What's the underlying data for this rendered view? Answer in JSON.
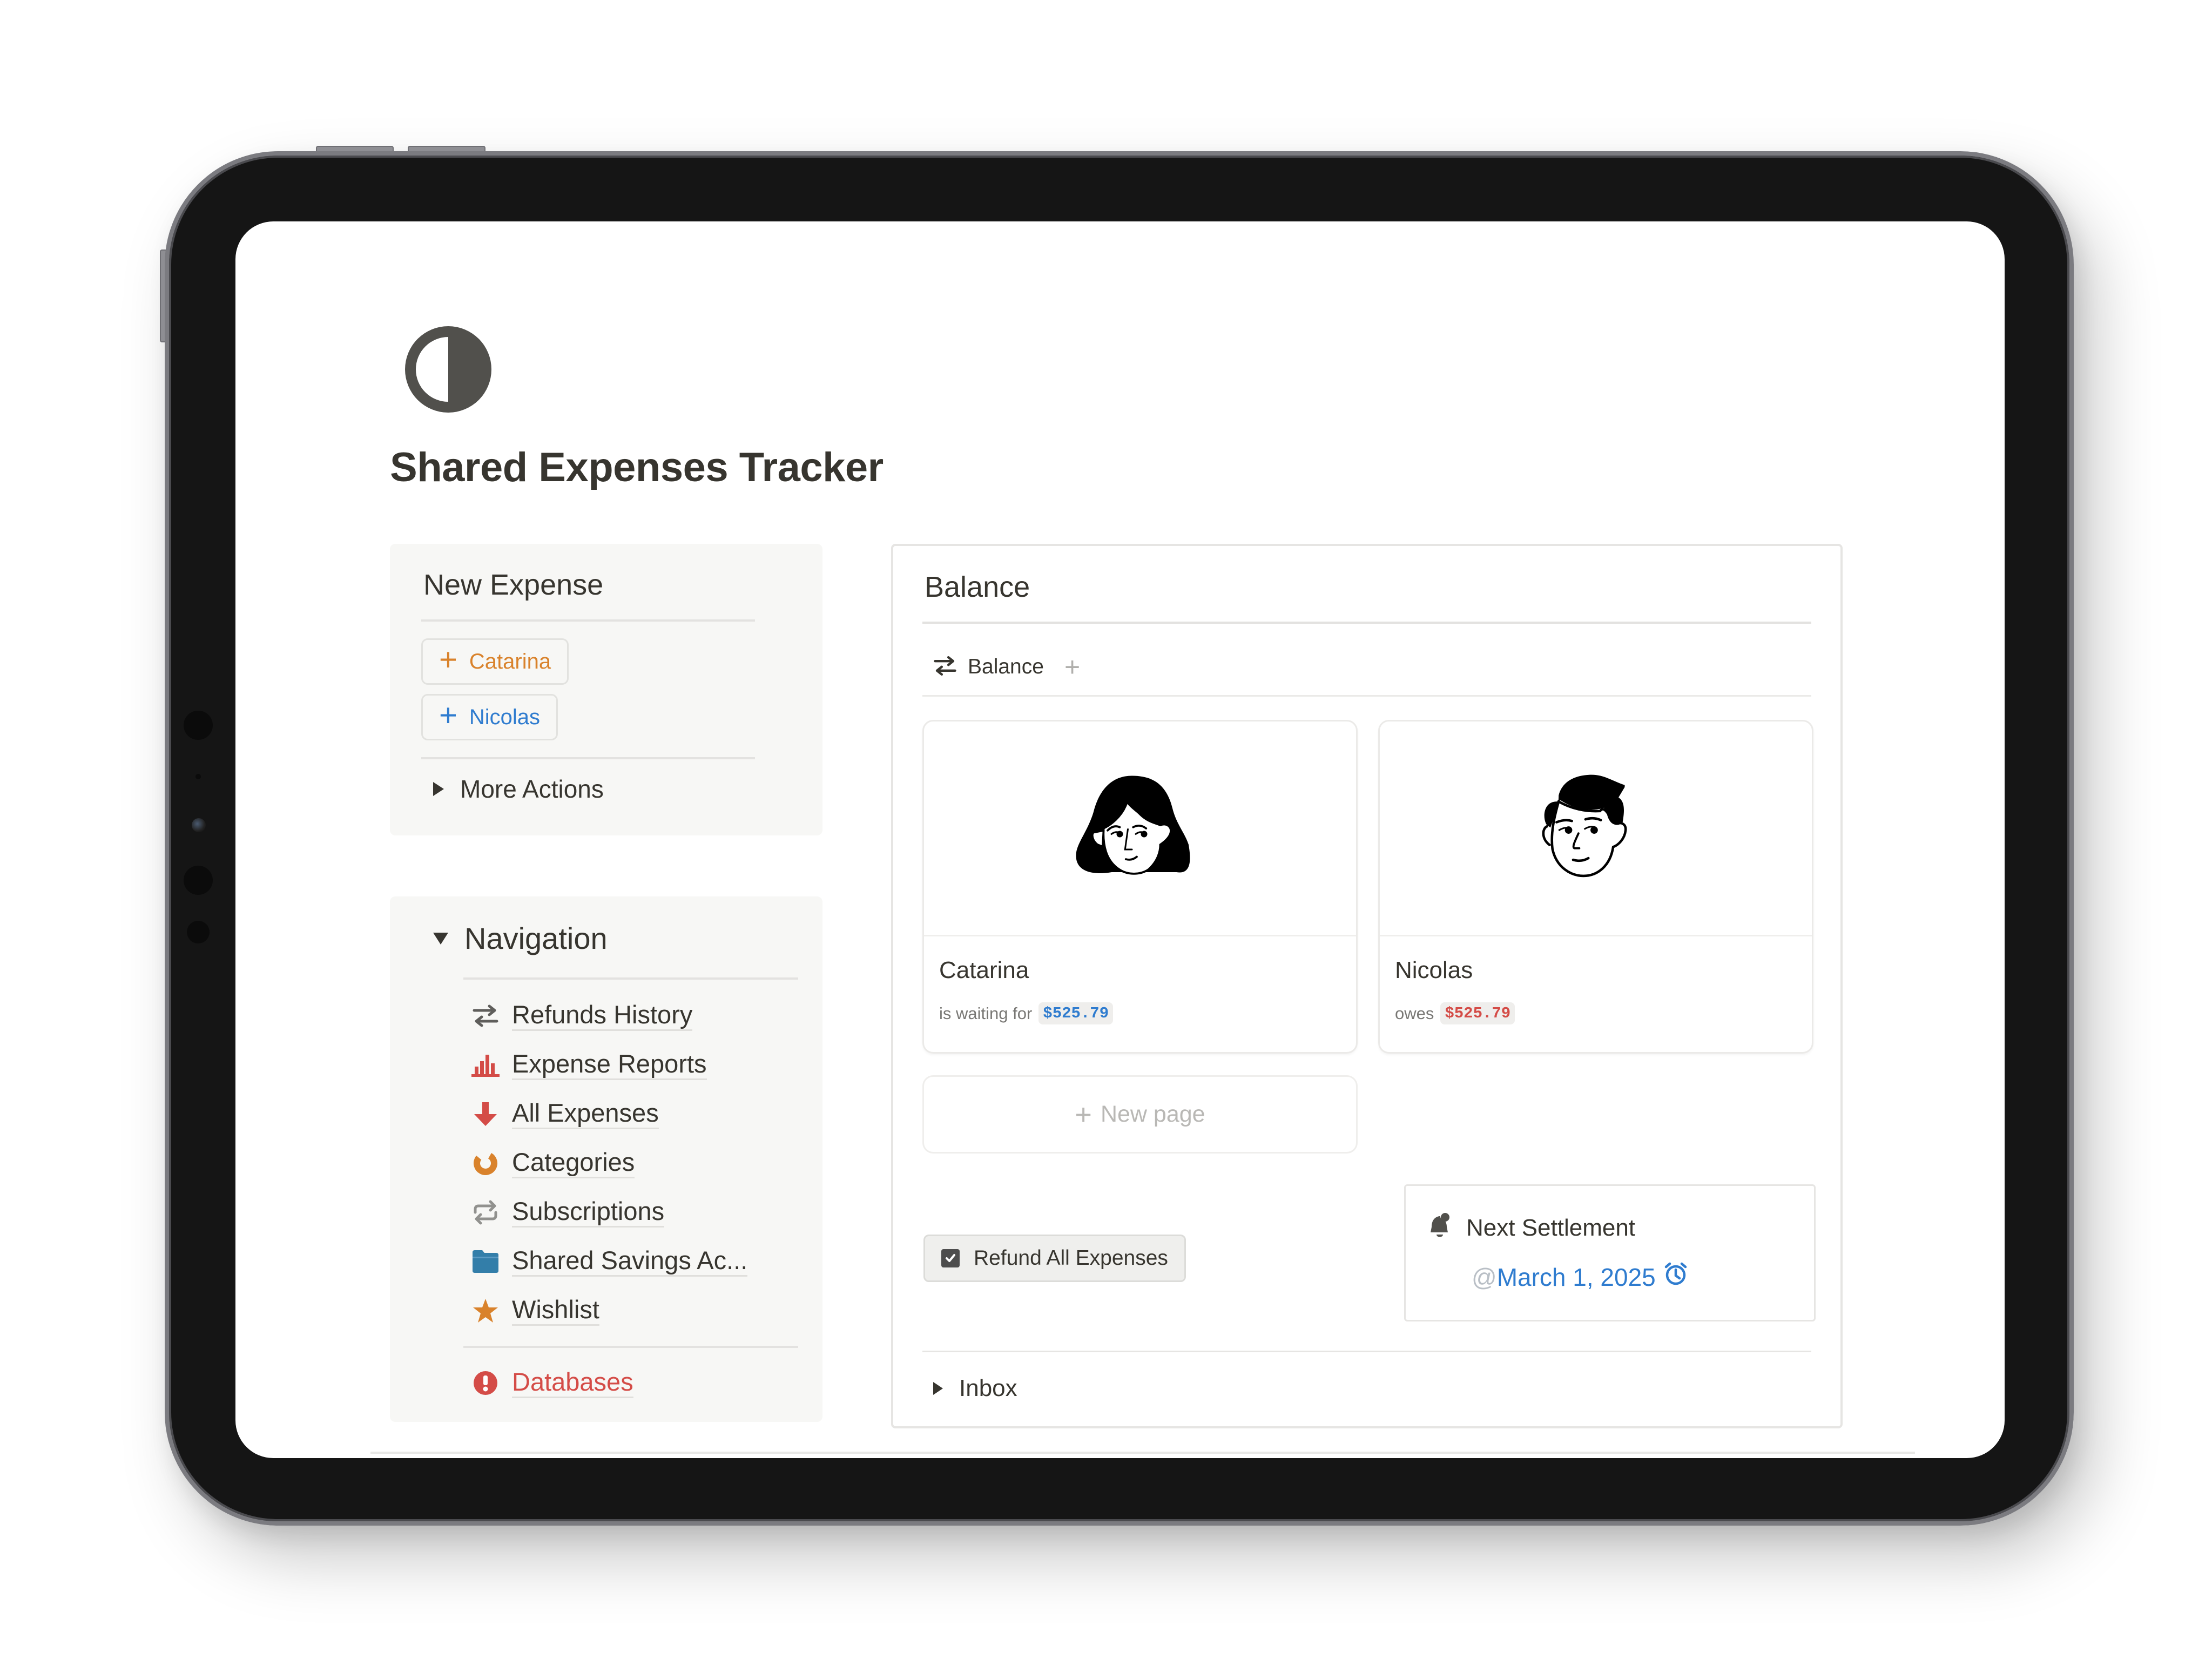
{
  "page": {
    "icon": "half-circle-contrast-icon",
    "title": "Shared Expenses Tracker"
  },
  "new_expense": {
    "heading": "New Expense",
    "buttons": [
      {
        "label": "Catarina",
        "icon": "plus-icon",
        "color": "#d9822b"
      },
      {
        "label": "Nicolas",
        "icon": "plus-icon",
        "color": "#2f7ccf"
      }
    ],
    "more_actions_label": "More Actions"
  },
  "navigation": {
    "heading": "Navigation",
    "items": [
      {
        "label": "Refunds History",
        "icon": "arrows-exchange-icon",
        "color": "#5f5e5b"
      },
      {
        "label": "Expense Reports",
        "icon": "bar-chart-icon",
        "color": "#d44c47"
      },
      {
        "label": "All Expenses",
        "icon": "arrow-down-icon",
        "color": "#d44c47"
      },
      {
        "label": "Categories",
        "icon": "pie-chart-icon",
        "color": "#d9822b"
      },
      {
        "label": "Subscriptions",
        "icon": "repeat-icon",
        "color": "#91918e"
      },
      {
        "label": "Shared Savings Ac...",
        "icon": "folder-icon",
        "color": "#337ea9"
      },
      {
        "label": "Wishlist",
        "icon": "star-icon",
        "color": "#d9822b"
      }
    ],
    "databases": {
      "label": "Databases",
      "icon": "alert-circle-icon",
      "color": "#d44c47"
    }
  },
  "balance": {
    "heading": "Balance",
    "tab": {
      "label": "Balance",
      "icon": "arrows-exchange-icon"
    },
    "add_view_icon": "plus-icon",
    "cards": [
      {
        "name": "Catarina",
        "status": "is waiting for",
        "amount": "$525.79",
        "amount_color": "#2f7ccf",
        "avatar": "woman-avatar"
      },
      {
        "name": "Nicolas",
        "status": "owes",
        "amount": "$525.79",
        "amount_color": "#d44c47",
        "avatar": "man-avatar"
      }
    ],
    "new_page_label": "New page",
    "refund_button_label": "Refund All Expenses",
    "next_settlement": {
      "heading": "Next Settlement",
      "at_symbol": "@",
      "date": "March 1, 2025",
      "date_color": "#2f7ccf"
    },
    "inbox_label": "Inbox"
  }
}
